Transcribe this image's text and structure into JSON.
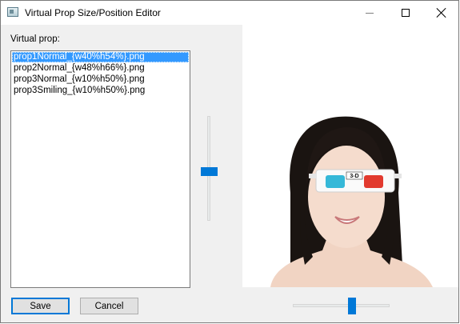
{
  "window": {
    "title": "Virtual Prop Size/Position Editor",
    "icon": "app-window-icon"
  },
  "titlebar_buttons": [
    "minimize-icon",
    "maximize-icon",
    "close-icon"
  ],
  "prop_panel": {
    "label": "Virtual prop:",
    "items": [
      {
        "label": "prop1Normal_{w40%h54%}.png",
        "selected": true
      },
      {
        "label": "prop2Normal_{w48%h66%}.png",
        "selected": false
      },
      {
        "label": "prop3Normal_{w10%h50%}.png",
        "selected": false
      },
      {
        "label": "prop3Smiling_{w10%h50%}.png",
        "selected": false
      }
    ]
  },
  "preview": {
    "description_icon": "face-with-3d-glasses-image",
    "glasses_label": "3-D"
  },
  "buttons": {
    "save_label": "Save",
    "cancel_label": "Cancel"
  },
  "sliders": {
    "vertical_level": 0.5,
    "horizontal_level": 0.6
  },
  "colors": {
    "accent": "#0078d7",
    "selection": "#3399ff"
  }
}
